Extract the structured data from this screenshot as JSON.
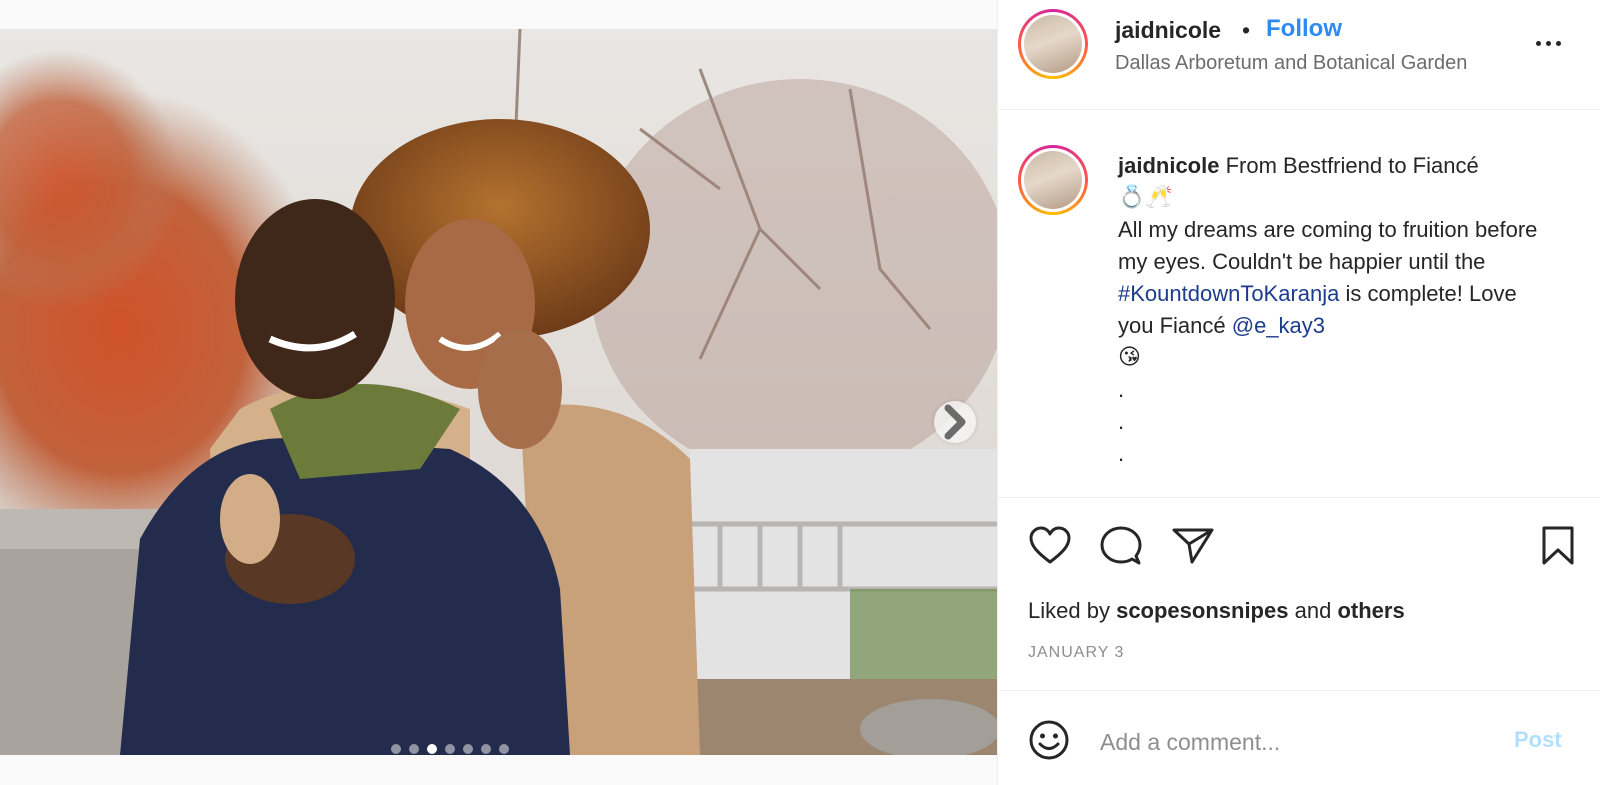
{
  "post": {
    "username": "jaidnicole",
    "separator": "•",
    "follow_label": "Follow",
    "location": "Dallas Arboretum and Botanical Garden",
    "carousel": {
      "total": 7,
      "active_index": 2
    }
  },
  "caption": {
    "username": "jaidnicole",
    "line1": "From Bestfriend to Fiancé",
    "emoji1": "💍🥂",
    "text1": "All my dreams are coming to fruition before my eyes. Couldn't be happier until the",
    "hashtag": "#KountdownToKaranja",
    "text2": "is complete! Love you Fiancé",
    "mention": "@e_kay3",
    "emoji2": "😘",
    "dots": [
      ".",
      ".",
      "."
    ]
  },
  "likes": {
    "prefix": "Liked by",
    "user": "scopesonsnipes",
    "middle": "and",
    "others": "others"
  },
  "date": "JANUARY 3",
  "comment": {
    "placeholder": "Add a comment...",
    "post_label": "Post"
  },
  "icons": {
    "like": "heart-icon",
    "comment": "comment-icon",
    "share": "paper-plane-icon",
    "save": "bookmark-icon",
    "emoji": "smiley-icon",
    "next": "chevron-right-icon",
    "more": "more-options-icon"
  },
  "colors": {
    "follow": "#2f8bf0",
    "link": "#1c3c8c",
    "post_disabled": "#b2dffc",
    "story_ring": [
      "#d6249f",
      "#fd5949",
      "#fdc100"
    ]
  }
}
